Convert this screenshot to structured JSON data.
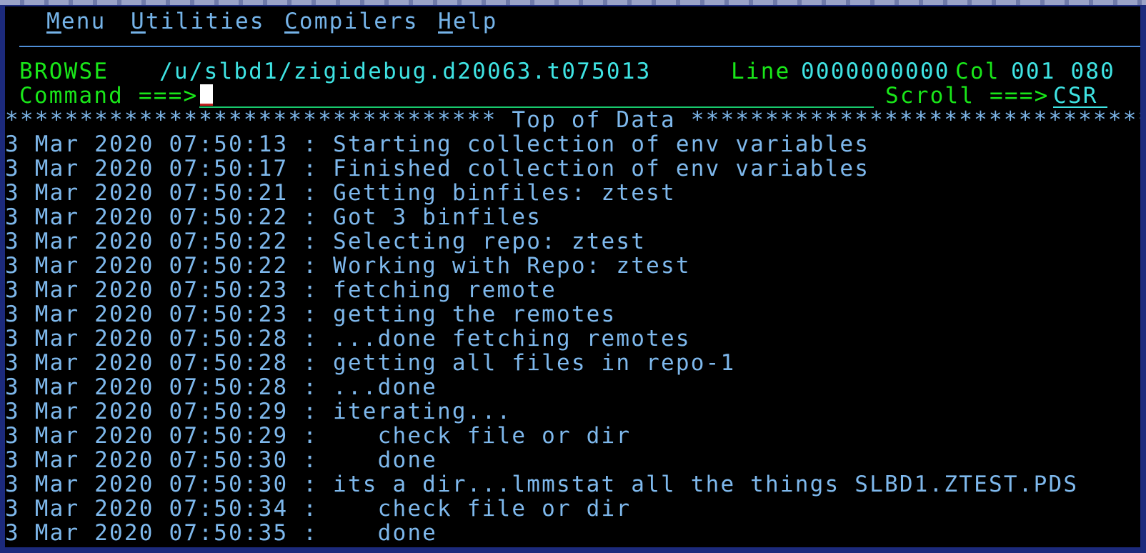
{
  "menubar": {
    "items": [
      {
        "label": "Menu",
        "hotkey": "M",
        "rest": "enu"
      },
      {
        "label": "Utilities",
        "hotkey": "U",
        "rest": "tilities"
      },
      {
        "label": "Compilers",
        "hotkey": "C",
        "rest": "ompilers"
      },
      {
        "label": "Help",
        "hotkey": "H",
        "rest": "elp"
      }
    ]
  },
  "header": {
    "mode": "BROWSE",
    "path": "/u/slbd1/zigidebug.d20063.t075013",
    "line_label": "Line",
    "line_value": "0000000000",
    "col_label": "Col",
    "col_value": "001 080"
  },
  "command": {
    "label": "Command ===>",
    "value": "",
    "scroll_label": "Scroll ===>",
    "scroll_value": "CSR"
  },
  "top_of_data": "********************************* Top of Data **********************************",
  "log_lines": [
    "3 Mar 2020 07:50:13 : Starting collection of env variables",
    "3 Mar 2020 07:50:17 : Finished collection of env variables",
    "3 Mar 2020 07:50:21 : Getting binfiles: ztest",
    "3 Mar 2020 07:50:22 : Got 3 binfiles",
    "3 Mar 2020 07:50:22 : Selecting repo: ztest",
    "3 Mar 2020 07:50:22 : Working with Repo: ztest",
    "3 Mar 2020 07:50:23 : fetching remote",
    "3 Mar 2020 07:50:23 : getting the remotes",
    "3 Mar 2020 07:50:28 : ...done fetching remotes",
    "3 Mar 2020 07:50:28 : getting all files in repo-1",
    "3 Mar 2020 07:50:28 : ...done",
    "3 Mar 2020 07:50:29 : iterating...",
    "3 Mar 2020 07:50:29 :    check file or dir",
    "3 Mar 2020 07:50:30 :    done",
    "3 Mar 2020 07:50:30 : its a dir...lmmstat all the things SLBD1.ZTEST.PDS",
    "3 Mar 2020 07:50:34 :    check file or dir",
    "3 Mar 2020 07:50:35 :    done"
  ],
  "colors": {
    "screen_bg": "#000000",
    "frame": "#1c2a7c",
    "green": "#19e619",
    "turquoise": "#3fe3e3",
    "blue": "#7eb8ec"
  }
}
